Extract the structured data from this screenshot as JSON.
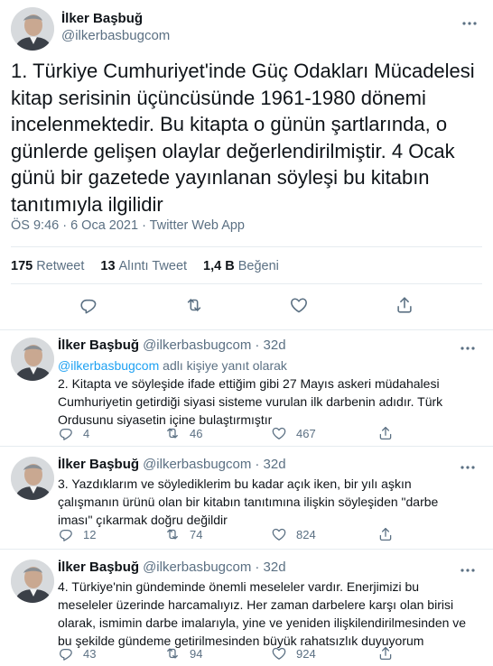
{
  "main_tweet": {
    "author_name": "İlker Başbuğ",
    "author_handle": "@ilkerbasbugcom",
    "text": "1. Türkiye Cumhuriyet'inde Güç Odakları Mücadelesi kitap serisinin üçüncüsünde 1961-1980 dönemi incelenmektedir. Bu kitapta o günün şartlarında, o günlerde gelişen olaylar değerlendirilmiştir. 4 Ocak günü bir gazetede yayınlanan söyleşi bu kitabın tanıtımıyla ilgilidir",
    "meta": "ÖS 9:46 · 6 Oca 2021 · Twitter Web App",
    "stats": {
      "retweets_count": "175",
      "retweets_label": "Retweet",
      "quotes_count": "13",
      "quotes_label": "Alıntı Tweet",
      "likes_count": "1,4 B",
      "likes_label": "Beğeni"
    }
  },
  "replies": [
    {
      "author_name": "İlker Başbuğ",
      "author_handle": "@ilkerbasbugcom",
      "time": "· 32d",
      "replying_handle": "@ilkerbasbugcom",
      "replying_suffix": " adlı kişiye yanıt olarak",
      "text": "2. Kitapta ve söyleşide ifade ettiğim gibi 27 Mayıs askeri müdahalesi Cumhuriyetin getirdiği siyasi sisteme vurulan ilk darbenin adıdır.  Türk Ordusunu siyasetin içine bulaştırmıştır",
      "reply_count": "4",
      "retweet_count": "46",
      "like_count": "467"
    },
    {
      "author_name": "İlker Başbuğ",
      "author_handle": "@ilkerbasbugcom",
      "time": "· 32d",
      "text": "3. Yazdıklarım ve söylediklerim bu kadar açık iken, bir yılı aşkın çalışmanın ürünü olan bir kitabın tanıtımına ilişkin söyleşiden \"darbe iması\" çıkarmak doğru değildir",
      "reply_count": "12",
      "retweet_count": "74",
      "like_count": "824"
    },
    {
      "author_name": "İlker Başbuğ",
      "author_handle": "@ilkerbasbugcom",
      "time": "· 32d",
      "text": "4. Türkiye'nin gündeminde önemli meseleler vardır. Enerjimizi bu meseleler üzerinde harcamalıyız. Her zaman darbelere karşı olan birisi olarak, ismimin darbe imalarıyla, yine ve yeniden ilişkilendirilmesinden ve bu şekilde gündeme getirilmesinden büyük rahatsızlık duyuyorum",
      "reply_count": "43",
      "retweet_count": "94",
      "like_count": "924"
    }
  ],
  "icons": {
    "more": "more-horizontal-icon",
    "reply": "reply-icon",
    "retweet": "retweet-icon",
    "like": "heart-icon",
    "share": "share-icon"
  },
  "colors": {
    "text": "#0f1419",
    "secondary": "#5b7083",
    "link": "#1da1f2",
    "divider": "#e6ecf0"
  }
}
